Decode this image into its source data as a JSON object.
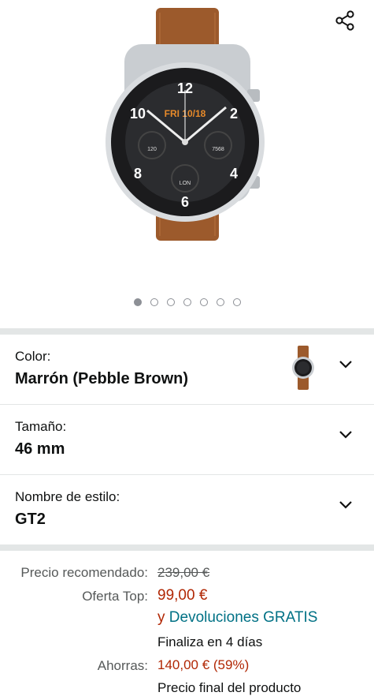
{
  "gallery": {
    "share_icon": "share-icon",
    "image_alt": "Huawei Watch GT2 46mm Pebble Brown",
    "watch_face": {
      "date": "FRI 10/18",
      "left_dial": "120",
      "right_dial": "7568",
      "bottom_dial": "LON",
      "numerals": [
        "12",
        "2",
        "4",
        "6",
        "8",
        "10"
      ]
    },
    "dot_count": 7,
    "active_dot": 0
  },
  "variations": [
    {
      "label": "Color:",
      "value": "Marrón (Pebble Brown)",
      "has_thumb": true
    },
    {
      "label": "Tamaño:",
      "value": "46 mm",
      "has_thumb": false
    },
    {
      "label": "Nombre de estilo:",
      "value": "GT2",
      "has_thumb": false
    }
  ],
  "price": {
    "rrp_label": "Precio recomendado:",
    "rrp_value": "239,00 €",
    "offer_label": "Oferta Top:",
    "offer_value": "99,00 €",
    "returns_prefix": "y",
    "returns_link": "Devoluciones GRATIS",
    "ends_text": "Finaliza en 4 días",
    "savings_label": "Ahorras:",
    "savings_value": "140,00 € (59%)",
    "final_text": "Precio final del producto"
  },
  "colors": {
    "price_red": "#b12704",
    "link_teal": "#007185",
    "divider": "#e3e6e6",
    "strap_brown": "#9c5a2c"
  }
}
